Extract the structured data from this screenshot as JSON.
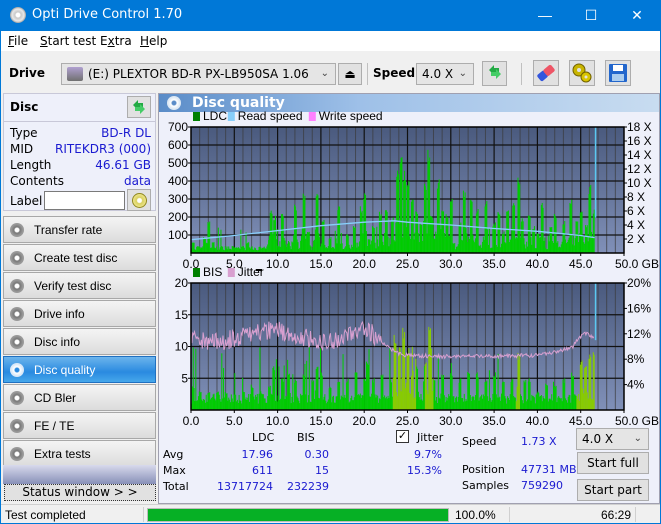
{
  "window": {
    "title": "Opti Drive Control 1.70",
    "minimize": "—",
    "maximize": "☐",
    "close": "✕"
  },
  "menu": [
    {
      "label": "File",
      "accel": "F",
      "rest": "ile"
    },
    {
      "label": "Start test",
      "accel": "S",
      "rest": "tart test"
    },
    {
      "label": "Extra",
      "accel": "x",
      "pre": "E",
      "rest": "tra"
    },
    {
      "label": "Help",
      "accel": "H",
      "rest": "elp"
    }
  ],
  "toolbar": {
    "drive_label": "Drive",
    "drive_value": "(E:)  PLEXTOR BD-R  PX-LB950SA 1.06",
    "speed_label": "Speed",
    "speed_value": "4.0 X",
    "eject_icon": "⏏",
    "refresh_icon": "⇄",
    "erase_icon": "eraser",
    "settings_icon": "gears",
    "save_icon": "floppy"
  },
  "disc": {
    "title": "Disc",
    "fields": [
      {
        "label": "Type",
        "value": "BD-R DL"
      },
      {
        "label": "MID",
        "value": "RITEKDR3 (000)"
      },
      {
        "label": "Length",
        "value": "46.61 GB"
      },
      {
        "label": "Contents",
        "value": "data"
      }
    ],
    "label_field": {
      "label": "Label",
      "value": ""
    }
  },
  "nav": [
    {
      "label": "Transfer rate",
      "active": false
    },
    {
      "label": "Create test disc",
      "active": false
    },
    {
      "label": "Verify test disc",
      "active": false
    },
    {
      "label": "Drive info",
      "active": false
    },
    {
      "label": "Disc info",
      "active": false
    },
    {
      "label": "Disc quality",
      "active": true
    },
    {
      "label": "CD Bler",
      "active": false
    },
    {
      "label": "FE / TE",
      "active": false
    },
    {
      "label": "Extra tests",
      "active": false
    }
  ],
  "status_window_button": "Status window > >",
  "panel": {
    "title": "Disc quality"
  },
  "chart_data": [
    {
      "type": "bar",
      "title": "",
      "legend": [
        "LDC",
        "Read speed",
        "Write speed"
      ],
      "legend_colors": [
        "#008000",
        "#87cefa",
        "#ff80ff"
      ],
      "legend_placement": "top-left",
      "xlabel": "GB",
      "x_ticks": [
        "0.0",
        "5.0",
        "10.0",
        "15.0",
        "20.0",
        "25.0",
        "30.0",
        "35.0",
        "40.0",
        "45.0",
        "50.0 GB"
      ],
      "xlim": [
        0,
        50
      ],
      "ylim": [
        0,
        700
      ],
      "y_ticks": [
        "100",
        "200",
        "300",
        "400",
        "500",
        "600",
        "700"
      ],
      "y2lim": [
        0,
        18
      ],
      "y2_ticks": [
        "2 X",
        "4 X",
        "6 X",
        "8 X",
        "10 X",
        "12 X",
        "14 X",
        "16 X",
        "18 X"
      ],
      "grid": true,
      "ldc_peaks": [
        [
          0.2,
          60
        ],
        [
          0.8,
          40
        ],
        [
          1.5,
          90
        ],
        [
          2.0,
          180
        ],
        [
          2.5,
          60
        ],
        [
          3.5,
          40
        ],
        [
          5.0,
          30
        ],
        [
          6.5,
          60
        ],
        [
          8.0,
          20
        ],
        [
          9.2,
          240
        ],
        [
          9.6,
          210
        ],
        [
          10.5,
          230
        ],
        [
          11.2,
          60
        ],
        [
          12.0,
          270
        ],
        [
          13.0,
          330
        ],
        [
          13.5,
          120
        ],
        [
          14.5,
          340
        ],
        [
          15.2,
          200
        ],
        [
          16.0,
          90
        ],
        [
          17.0,
          260
        ],
        [
          18.0,
          110
        ],
        [
          18.8,
          150
        ],
        [
          19.6,
          260
        ],
        [
          20.0,
          340
        ],
        [
          20.5,
          80
        ],
        [
          21.0,
          150
        ],
        [
          21.8,
          240
        ],
        [
          22.5,
          260
        ],
        [
          23.2,
          200
        ],
        [
          23.8,
          470
        ],
        [
          24.2,
          540
        ],
        [
          24.6,
          470
        ],
        [
          25.0,
          420
        ],
        [
          25.5,
          300
        ],
        [
          26.0,
          250
        ],
        [
          26.5,
          180
        ],
        [
          27.0,
          400
        ],
        [
          27.4,
          600
        ],
        [
          27.8,
          200
        ],
        [
          28.5,
          420
        ],
        [
          29.0,
          270
        ],
        [
          29.5,
          220
        ],
        [
          30.0,
          310
        ],
        [
          31.0,
          170
        ],
        [
          31.5,
          350
        ],
        [
          32.3,
          300
        ],
        [
          33.0,
          250
        ],
        [
          34.0,
          290
        ],
        [
          35.0,
          170
        ],
        [
          35.5,
          230
        ],
        [
          36.0,
          120
        ],
        [
          36.5,
          240
        ],
        [
          37.2,
          300
        ],
        [
          37.8,
          440
        ],
        [
          38.2,
          200
        ],
        [
          39.0,
          210
        ],
        [
          39.5,
          150
        ],
        [
          40.0,
          120
        ],
        [
          40.5,
          280
        ],
        [
          41.5,
          160
        ],
        [
          42.0,
          220
        ],
        [
          43.0,
          180
        ],
        [
          43.8,
          300
        ],
        [
          44.5,
          190
        ],
        [
          45.0,
          240
        ],
        [
          45.6,
          160
        ],
        [
          46.0,
          380
        ],
        [
          46.5,
          250
        ]
      ],
      "ldc_baseline": 30,
      "read_speed": [
        [
          0,
          1.9
        ],
        [
          5,
          2.5
        ],
        [
          10,
          3.2
        ],
        [
          15,
          3.9
        ],
        [
          20,
          4.4
        ],
        [
          23.5,
          4.6
        ],
        [
          25,
          4.4
        ],
        [
          30,
          4.0
        ],
        [
          35,
          3.5
        ],
        [
          40,
          3.1
        ],
        [
          45,
          2.5
        ],
        [
          46.6,
          2.2
        ]
      ]
    },
    {
      "type": "bar",
      "title": "",
      "legend": [
        "BIS",
        "Jitter"
      ],
      "legend_colors": [
        "#008000",
        "#d8a0d0"
      ],
      "legend_placement": "top-left",
      "xlabel": "GB",
      "x_ticks": [
        "0.0",
        "5.0",
        "10.0",
        "15.0",
        "20.0",
        "25.0",
        "30.0",
        "35.0",
        "40.0",
        "45.0",
        "50.0 GB"
      ],
      "xlim": [
        0,
        50
      ],
      "ylim": [
        0,
        20
      ],
      "y_ticks": [
        "5",
        "10",
        "15",
        "20"
      ],
      "y2lim": [
        0,
        20
      ],
      "y2_ticks": [
        "4%",
        "8%",
        "12%",
        "16%",
        "20%"
      ],
      "grid": true,
      "bis_peaks": [
        [
          0.2,
          4
        ],
        [
          1.0,
          3
        ],
        [
          2.0,
          3
        ],
        [
          3.0,
          3
        ],
        [
          4.0,
          3
        ],
        [
          6.0,
          3
        ],
        [
          7.0,
          4
        ],
        [
          8.0,
          3
        ],
        [
          9.0,
          4
        ],
        [
          9.5,
          7
        ],
        [
          10.5,
          5
        ],
        [
          11.2,
          6
        ],
        [
          12.0,
          5
        ],
        [
          13.0,
          6
        ],
        [
          14.0,
          5
        ],
        [
          14.5,
          7
        ],
        [
          15.0,
          6
        ],
        [
          16.0,
          4
        ],
        [
          17.0,
          5
        ],
        [
          18.0,
          5
        ],
        [
          19.0,
          6
        ],
        [
          20.0,
          5
        ],
        [
          20.3,
          8
        ],
        [
          21.0,
          5
        ],
        [
          22.0,
          6
        ],
        [
          23.0,
          5
        ],
        [
          23.5,
          12
        ],
        [
          24.0,
          10
        ],
        [
          24.5,
          13
        ],
        [
          25.0,
          10
        ],
        [
          25.5,
          6
        ],
        [
          26.0,
          7
        ],
        [
          27.0,
          8
        ],
        [
          27.5,
          14
        ],
        [
          28.0,
          5
        ],
        [
          29.0,
          6
        ],
        [
          30.0,
          6
        ],
        [
          31.0,
          5
        ],
        [
          32.0,
          6
        ],
        [
          33.0,
          6
        ],
        [
          34.0,
          5
        ],
        [
          35.0,
          6
        ],
        [
          36.0,
          5
        ],
        [
          37.0,
          5
        ],
        [
          37.8,
          9
        ],
        [
          38.5,
          5
        ],
        [
          39.0,
          5
        ],
        [
          40.0,
          3
        ],
        [
          41.0,
          4
        ],
        [
          42.0,
          4
        ],
        [
          43.0,
          5
        ],
        [
          44.0,
          6
        ],
        [
          45.0,
          8
        ],
        [
          45.5,
          7
        ],
        [
          46.0,
          9
        ],
        [
          46.5,
          10
        ]
      ],
      "bis_baseline": 2,
      "jitter_pct": [
        [
          0,
          12
        ],
        [
          1,
          10.8
        ],
        [
          3,
          10.8
        ],
        [
          5,
          11.2
        ],
        [
          7,
          12
        ],
        [
          9,
          12.5
        ],
        [
          11,
          12.3
        ],
        [
          13,
          11.5
        ],
        [
          15,
          10.8
        ],
        [
          17,
          11.2
        ],
        [
          19,
          12.2
        ],
        [
          20,
          12.8
        ],
        [
          21,
          12
        ],
        [
          22,
          10.8
        ],
        [
          23,
          9.7
        ],
        [
          24,
          8.8
        ],
        [
          25,
          8.6
        ],
        [
          30,
          8.4
        ],
        [
          35,
          8.5
        ],
        [
          40,
          8.6
        ],
        [
          42,
          9.2
        ],
        [
          44,
          9.8
        ],
        [
          44.5,
          10.8
        ],
        [
          45.5,
          12.2
        ],
        [
          46.6,
          11.2
        ]
      ]
    }
  ],
  "stats": {
    "headers": [
      "LDC",
      "BIS"
    ],
    "rows": [
      {
        "label": "Avg",
        "ldc": "17.96",
        "bis": "0.30",
        "jitter": "9.7%"
      },
      {
        "label": "Max",
        "ldc": "611",
        "bis": "15",
        "jitter": "15.3%"
      },
      {
        "label": "Total",
        "ldc": "13717724",
        "bis": "232239",
        "jitter": ""
      }
    ],
    "jitter_label": "Jitter",
    "jitter_checked": true,
    "speed_label": "Speed",
    "speed_value": "1.73 X",
    "position_label": "Position",
    "position_value": "47731 MB",
    "samples_label": "Samples",
    "samples_value": "759290",
    "speed_select": "4.0 X",
    "start_full": "Start full",
    "start_part": "Start part"
  },
  "statusbar": {
    "text": "Test completed",
    "progress": 1.0,
    "percent": "100.0%",
    "time": "66:29"
  }
}
